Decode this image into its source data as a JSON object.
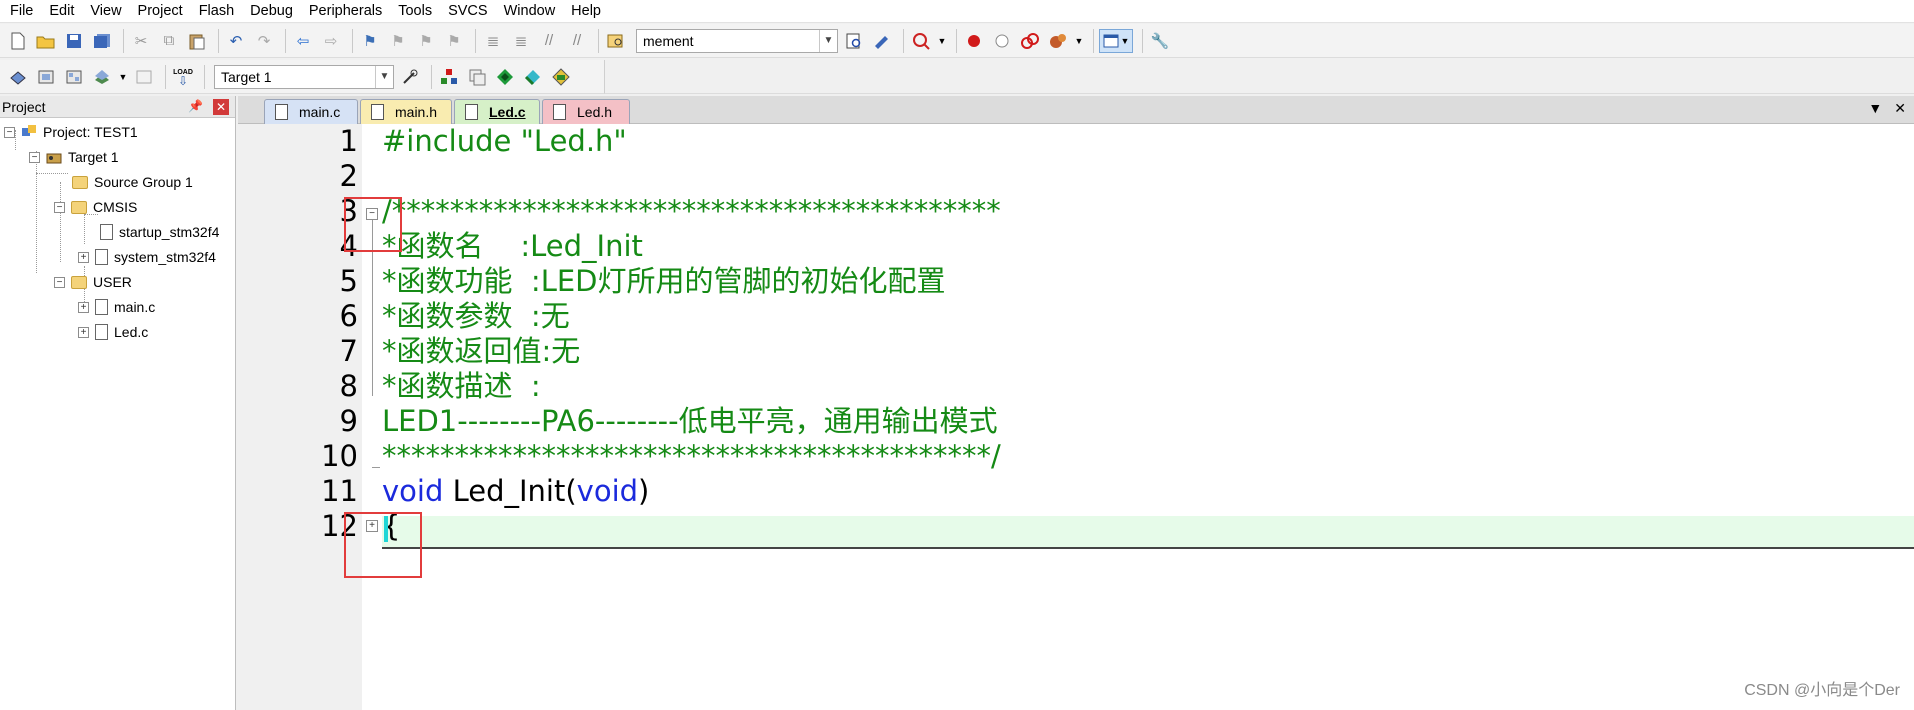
{
  "menu": [
    "File",
    "Edit",
    "View",
    "Project",
    "Flash",
    "Debug",
    "Peripherals",
    "Tools",
    "SVCS",
    "Window",
    "Help"
  ],
  "toolbar": {
    "find_combo_value": "mement",
    "target_combo_value": "Target 1",
    "load_label": "LOAD"
  },
  "project_panel": {
    "title": "Project",
    "tree": {
      "project": "Project: TEST1",
      "target": "Target 1",
      "source_group": "Source Group 1",
      "cmsis": "CMSIS",
      "startup": "startup_stm32f4",
      "system": "system_stm32f4",
      "user": "USER",
      "main_c": "main.c",
      "led_c": "Led.c"
    }
  },
  "tabs": [
    {
      "label": "main.c",
      "bg": "#d6e2f5"
    },
    {
      "label": "main.h",
      "bg": "#f9ecb0"
    },
    {
      "label": "Led.c",
      "bg": "#d6f0c8"
    },
    {
      "label": "Led.h",
      "bg": "#f4c0c6"
    }
  ],
  "editor": {
    "lines": [
      {
        "n": "1",
        "text": "#include \"Led.h\""
      },
      {
        "n": "2",
        "text": ""
      },
      {
        "n": "3",
        "text": "/******************************************"
      },
      {
        "n": "4",
        "text": "*函数名    :Led_Init"
      },
      {
        "n": "5",
        "text": "*函数功能  :LED灯所用的管脚的初始化配置"
      },
      {
        "n": "6",
        "text": "*函数参数  :无"
      },
      {
        "n": "7",
        "text": "*函数返回值:无"
      },
      {
        "n": "8",
        "text": "*函数描述  :"
      },
      {
        "n": "9",
        "text": "LED1--------PA6--------低电平亮，通用输出模式"
      },
      {
        "n": "10",
        "text": "******************************************/"
      },
      {
        "n": "11",
        "kw1": "void",
        "mid": " Led_Init(",
        "kw2": "void",
        "end": ")"
      },
      {
        "n": "12",
        "text": "{"
      }
    ]
  },
  "watermark": "CSDN @小向是个Der",
  "colors": {
    "comment": "#158a15",
    "keyword": "#1b2adc",
    "highlight": "#e6fbe9",
    "annotation": "#e23c3c"
  }
}
